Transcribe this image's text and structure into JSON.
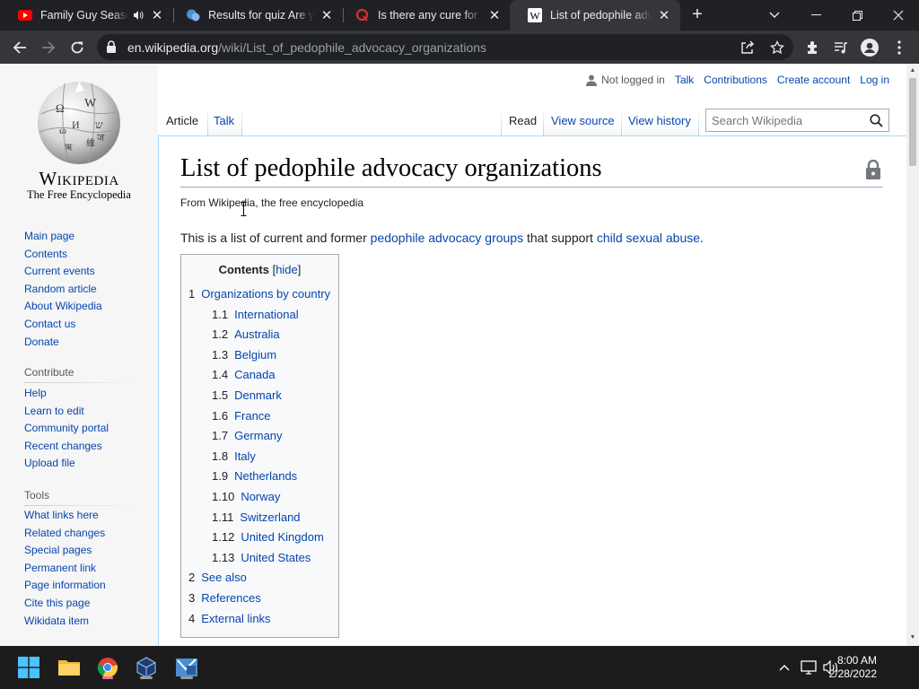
{
  "browser": {
    "tabs": [
      {
        "title": "Family Guy Season",
        "favicon": "youtube-icon",
        "audio": true
      },
      {
        "title": "Results for quiz Are you",
        "favicon": "quiz-icon"
      },
      {
        "title": "Is there any cure for pe",
        "favicon": "quora-icon"
      },
      {
        "title": "List of pedophile advoc",
        "favicon": "wikipedia-icon",
        "active": true
      }
    ],
    "url_host": "en.wikipedia.org",
    "url_path": "/wiki/List_of_pedophile_advocacy_organizations"
  },
  "sidebar": {
    "wordmark": "Wikipedia",
    "tagline": "The Free Encyclopedia",
    "navigation": [
      "Main page",
      "Contents",
      "Current events",
      "Random article",
      "About Wikipedia",
      "Contact us",
      "Donate"
    ],
    "contribute_heading": "Contribute",
    "contribute": [
      "Help",
      "Learn to edit",
      "Community portal",
      "Recent changes",
      "Upload file"
    ],
    "tools_heading": "Tools",
    "tools": [
      "What links here",
      "Related changes",
      "Special pages",
      "Permanent link",
      "Page information",
      "Cite this page",
      "Wikidata item"
    ]
  },
  "personal": {
    "status": "Not logged in",
    "links": [
      "Talk",
      "Contributions",
      "Create account",
      "Log in"
    ]
  },
  "tabs": {
    "article": "Article",
    "talk": "Talk",
    "read": "Read",
    "view_source": "View source",
    "view_history": "View history"
  },
  "search": {
    "placeholder": "Search Wikipedia"
  },
  "article": {
    "title": "List of pedophile advocacy organizations",
    "site_sub": "From Wikipedia, the free encyclopedia",
    "intro_before": "This is a list of current and former ",
    "intro_link1": "pedophile advocacy groups",
    "intro_mid": " that support ",
    "intro_link2": "child sexual abuse",
    "intro_after": "."
  },
  "toc": {
    "title": "Contents",
    "toggle": "hide",
    "items": [
      {
        "num": "1",
        "text": "Organizations by country",
        "level": 1
      },
      {
        "num": "1.1",
        "text": "International",
        "level": 2
      },
      {
        "num": "1.2",
        "text": "Australia",
        "level": 2
      },
      {
        "num": "1.3",
        "text": "Belgium",
        "level": 2
      },
      {
        "num": "1.4",
        "text": "Canada",
        "level": 2
      },
      {
        "num": "1.5",
        "text": "Denmark",
        "level": 2
      },
      {
        "num": "1.6",
        "text": "France",
        "level": 2
      },
      {
        "num": "1.7",
        "text": "Germany",
        "level": 2
      },
      {
        "num": "1.8",
        "text": "Italy",
        "level": 2
      },
      {
        "num": "1.9",
        "text": "Netherlands",
        "level": 2
      },
      {
        "num": "1.10",
        "text": "Norway",
        "level": 2
      },
      {
        "num": "1.11",
        "text": "Switzerland",
        "level": 2
      },
      {
        "num": "1.12",
        "text": "United Kingdom",
        "level": 2
      },
      {
        "num": "1.13",
        "text": "United States",
        "level": 2
      },
      {
        "num": "2",
        "text": "See also",
        "level": 1
      },
      {
        "num": "3",
        "text": "References",
        "level": 1
      },
      {
        "num": "4",
        "text": "External links",
        "level": 1
      }
    ]
  },
  "taskbar": {
    "apps": [
      "start-icon",
      "file-explorer-icon",
      "chrome-icon",
      "virtualbox-icon",
      "app-icon"
    ],
    "time": "8:00 AM",
    "date": "2/28/2022"
  },
  "colors": {
    "link": "#0645ad",
    "chrome_dark": "#202124",
    "chrome_toolbar": "#35363a",
    "taskbar": "#1c1c1c"
  }
}
